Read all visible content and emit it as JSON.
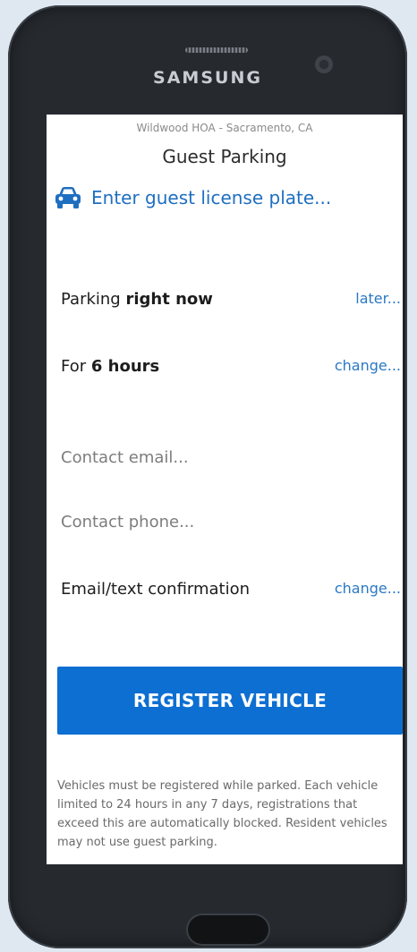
{
  "device": {
    "brand": "SAMSUNG"
  },
  "header": {
    "location": "Wildwood HOA - Sacramento, CA",
    "title": "Guest Parking"
  },
  "plate": {
    "icon": "car-icon",
    "placeholder": "Enter guest license plate..."
  },
  "timing": {
    "start_prefix": "Parking ",
    "start_value": "right now",
    "start_link": "later...",
    "duration_prefix": "For ",
    "duration_value": "6 hours",
    "duration_link": "change..."
  },
  "contact": {
    "email_placeholder": "Contact email...",
    "phone_placeholder": "Contact phone...",
    "confirmation_label": "Email/text confirmation",
    "confirmation_link": "change..."
  },
  "actions": {
    "register_label": "REGISTER VEHICLE",
    "register_color": "#0d6fd1"
  },
  "footer": {
    "disclaimer": "Vehicles must be registered while parked. Each vehicle limited to 24 hours in any 7 days, registrations that exceed this are automatically blocked. Resident vehicles may not use guest parking."
  },
  "colors": {
    "link": "#2a78c4",
    "accent": "#1f6fc0"
  }
}
